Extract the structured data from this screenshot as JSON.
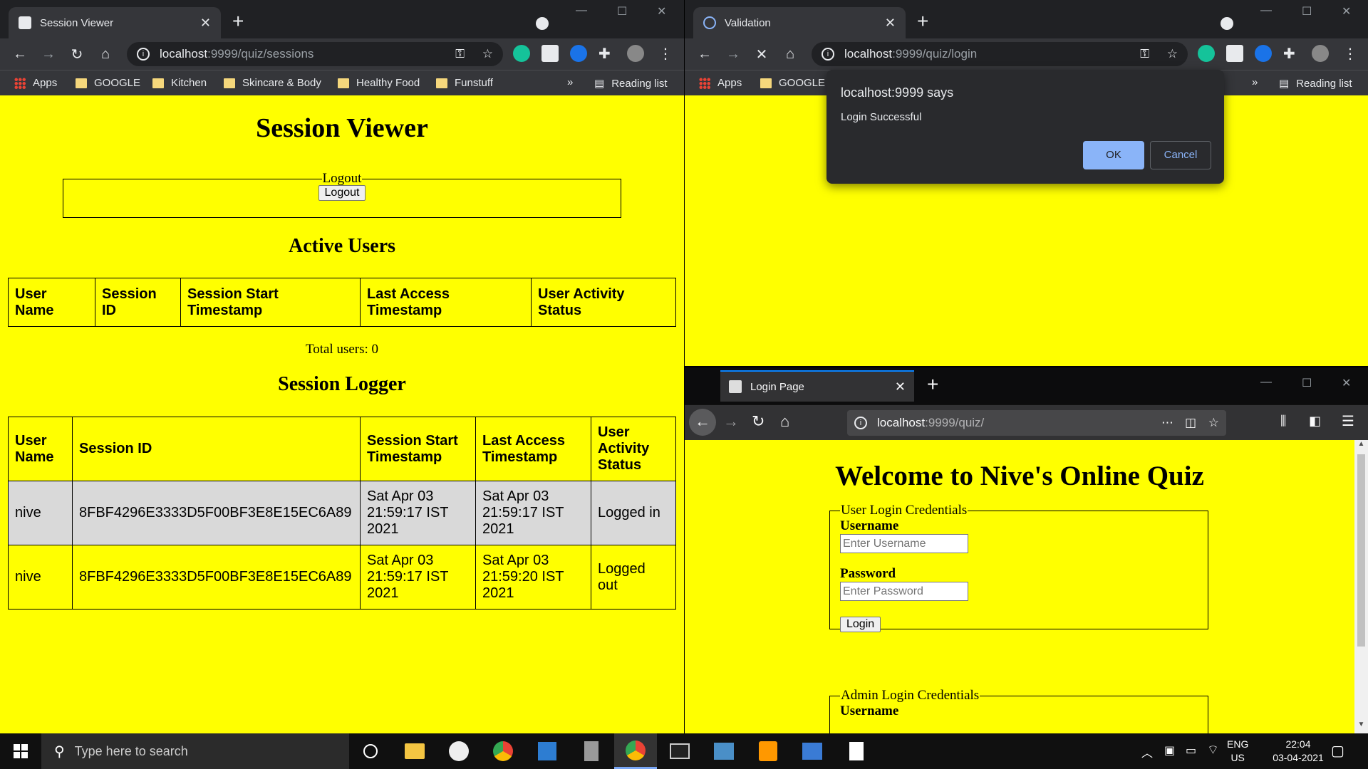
{
  "left_window": {
    "tab_title": "Session Viewer",
    "url_host": "localhost",
    "url_path": ":9999/quiz/sessions",
    "bookmarks": [
      "Apps",
      "GOOGLE",
      "Kitchen",
      "Skincare & Body",
      "Healthy Food",
      "Funstuff"
    ],
    "reading_list": "Reading list",
    "page": {
      "title": "Session Viewer",
      "logout_legend": "Logout",
      "logout_button": "Logout",
      "active_users_heading": "Active Users",
      "active_headers": [
        "User Name",
        "Session ID",
        "Session Start Timestamp",
        "Last Access Timestamp",
        "User Activity Status"
      ],
      "total_users": "Total users: 0",
      "logger_heading": "Session Logger",
      "logger_headers": [
        "User Name",
        "Session ID",
        "Session Start Timestamp",
        "Last Access Timestamp",
        "User Activity Status"
      ],
      "logger_rows": [
        [
          "nive",
          "8FBF4296E3333D5F00BF3E8E15EC6A89",
          "Sat Apr 03 21:59:17 IST 2021",
          "Sat Apr 03 21:59:17 IST 2021",
          "Logged in"
        ],
        [
          "nive",
          "8FBF4296E3333D5F00BF3E8E15EC6A89",
          "Sat Apr 03 21:59:17 IST 2021",
          "Sat Apr 03 21:59:20 IST 2021",
          "Logged out"
        ]
      ]
    }
  },
  "right_top_window": {
    "tab_title": "Validation",
    "url_host": "localhost",
    "url_path": ":9999/quiz/login",
    "bookmarks": [
      "Apps",
      "GOOGLE"
    ],
    "reading_list": "Reading list",
    "dialog": {
      "title": "localhost:9999 says",
      "message": "Login Successful",
      "ok": "OK",
      "cancel": "Cancel"
    }
  },
  "right_bottom_window": {
    "tab_title": "Login Page",
    "url_host": "localhost",
    "url_path": ":9999/quiz/",
    "page": {
      "title": "Welcome to Nive's Online Quiz",
      "user_legend": "User Login Credentials",
      "username_label": "Username",
      "username_placeholder": "Enter Username",
      "password_label": "Password",
      "password_placeholder": "Enter Password",
      "login_button": "Login",
      "admin_legend": "Admin Login Credentials",
      "admin_username_label": "Username"
    }
  },
  "taskbar": {
    "search_placeholder": "Type here to search",
    "lang": "ENG",
    "region": "US",
    "time": "22:04",
    "date": "03-04-2021"
  },
  "colors": {
    "page_bg": "#ffff00",
    "chrome_dark": "#35363a",
    "dialog_ok": "#8ab4f8"
  }
}
